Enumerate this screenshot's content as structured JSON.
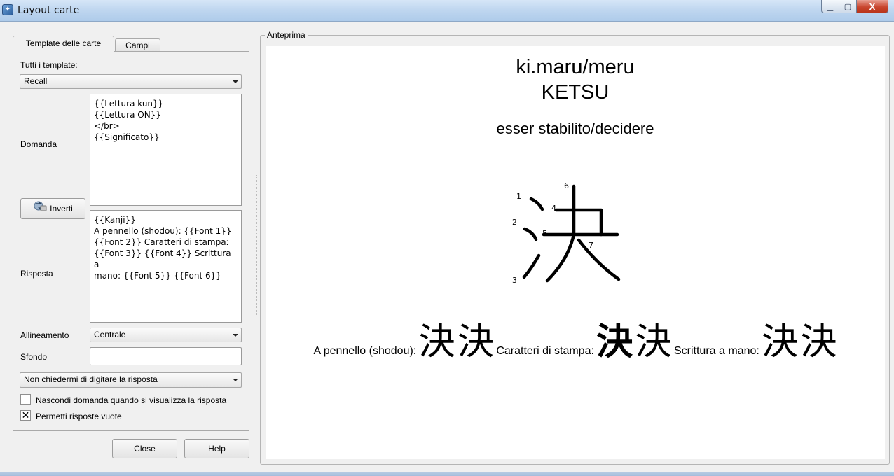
{
  "window": {
    "title": "Layout carte",
    "icon": "app-card-icon",
    "controls": {
      "minimize": "▁",
      "maximize": "▢",
      "close": "X"
    }
  },
  "tabs": [
    {
      "label": "Template delle carte",
      "active": true
    },
    {
      "label": "Campi",
      "active": false
    }
  ],
  "templates": {
    "label": "Tutti i template:",
    "selected": "Recall"
  },
  "question": {
    "label": "Domanda",
    "text": "{{Lettura kun}}\n{{Lettura ON}}\n</br>\n{{Significato}}"
  },
  "swap_button": {
    "label": "Inverti",
    "icon": "swap-arrows-icon"
  },
  "answer": {
    "label": "Risposta",
    "text": "{{Kanji}}\nA pennello (shodou): {{Font 1}}\n{{Font 2}} Caratteri di stampa:\n{{Font 3}} {{Font 4}} Scrittura a\nmano: {{Font 5}} {{Font 6}}"
  },
  "alignment": {
    "label": "Allineamento",
    "selected": "Centrale"
  },
  "background": {
    "label": "Sfondo",
    "value": ""
  },
  "typing_mode": {
    "selected": "Non chiedermi di digitare la risposta"
  },
  "options": [
    {
      "label": "Nascondi domanda quando si visualizza la risposta",
      "checked": false
    },
    {
      "label": "Permetti risposte vuote",
      "checked": true,
      "mark": "✕"
    }
  ],
  "buttons": {
    "close": "Close",
    "help": "Help"
  },
  "preview": {
    "group_label": "Anteprima",
    "kun_reading": "ki.maru/meru",
    "on_reading": "KETSU",
    "meaning": "esser stabilito/decidere",
    "kanji": "決",
    "stroke_numbers": [
      "1",
      "2",
      "3",
      "4",
      "5",
      "6",
      "7"
    ],
    "brush_label": "A pennello (shodou):",
    "print_label": "Caratteri di stampa:",
    "hand_label": "Scrittura a mano:",
    "font_samples": [
      "決",
      "決",
      "決",
      "決",
      "決",
      "決"
    ]
  }
}
